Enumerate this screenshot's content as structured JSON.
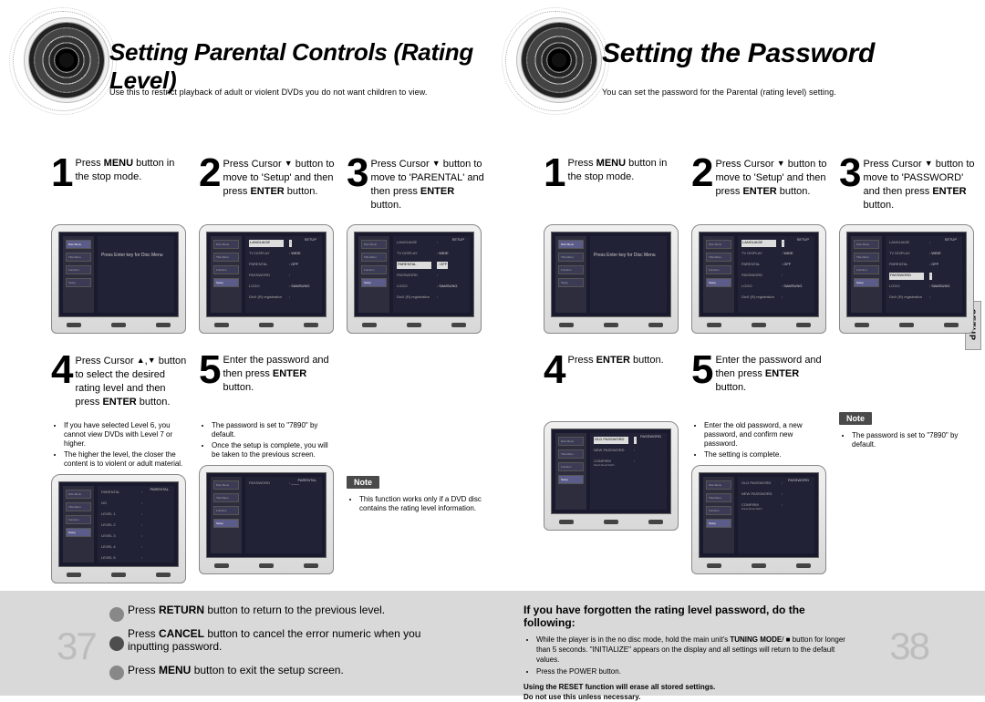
{
  "left": {
    "title": "Setting Parental Controls (Rating Level)",
    "subtitle": "Use this to restrict playback of adult or violent DVDs you do not want children to view.",
    "page_num": "37",
    "steps_row1": [
      {
        "num": "1",
        "text": "Press <b>MENU</b> button in the stop mode."
      },
      {
        "num": "2",
        "text": "Press Cursor <span class='tri'>▼</span> button to move to 'Setup' and then press <b>ENTER</b> button."
      },
      {
        "num": "3",
        "text": "Press Cursor <span class='tri'>▼</span> button to move to 'PARENTAL' and then press <b>ENTER</b> button."
      }
    ],
    "steps_row2": [
      {
        "num": "4",
        "text": "Press Cursor <span class='tri'>▲</span>,<span class='tri'>▼</span> button to select the desired rating level and then press <b>ENTER</b> button.",
        "bullets": [
          "If you have selected Level 6, you cannot view DVDs with Level 7 or higher.",
          "The higher the level, the closer the content is to violent or adult material."
        ]
      },
      {
        "num": "5",
        "text": "Enter the password and then press <b>ENTER</b> button.",
        "bullets": [
          "The password is set to \"7890\" by default.",
          "Once the setup is complete, you will be taken to the previous screen."
        ]
      }
    ],
    "note_label": "Note",
    "note_bullet": "This function works only if a DVD disc contains the rating level information.",
    "footer": [
      "Press <b>RETURN</b> button to return to the previous level.",
      "Press <b>CANCEL</b> button to cancel the error numeric when you inputting password.",
      "Press <b>MENU</b> button to exit the setup screen."
    ]
  },
  "right": {
    "title": "Setting the Password",
    "subtitle": "You can set the password for the Parental (rating level) setting.",
    "page_num": "38",
    "side_tab": "SETUP",
    "steps_row1": [
      {
        "num": "1",
        "text": "Press <b>MENU</b> button in the stop mode."
      },
      {
        "num": "2",
        "text": "Press Cursor <span class='tri'>▼</span> button to move to 'Setup' and then press <b>ENTER</b> button."
      },
      {
        "num": "3",
        "text": "Press Cursor <span class='tri'>▼</span> button to move to 'PASSWORD' and then press <b>ENTER</b> button."
      }
    ],
    "steps_row2": [
      {
        "num": "4",
        "text": "Press <b>ENTER</b> button."
      },
      {
        "num": "5",
        "text": "Enter the password and then press <b>ENTER</b> button.",
        "bullets": [
          "Enter the old password, a new password, and confirm new password.",
          "The setting is complete."
        ]
      }
    ],
    "note_label": "Note",
    "note_bullet": "The password is set to \"7890\" by default.",
    "footer_headline": "If you have forgotten the rating level password, do the following:",
    "footer_bullets": [
      "While the player is in the no disc mode, hold the main unit's <b>TUNING MODE</b>/ ■ button for longer than 5 seconds. \"INITIALIZE\" appears on the display and all settings will return to the default values.",
      "Press the POWER button."
    ],
    "footer_warn1": "Using the RESET function will erase all stored settings.",
    "footer_warn2": "Do not use this unless necessary.",
    "tv4_rows": [
      "OLD PASSWORD",
      "NEW PASSWORD",
      "CONFIRM PASSWORD"
    ]
  },
  "tv_setup_menu": [
    "Disc Menu",
    "Title Menu",
    "Function",
    "Setup"
  ],
  "tv_setup_rows": [
    {
      "lbl": "LANGUAGE",
      "val": ""
    },
    {
      "lbl": "TV DISPLAY",
      "val": "WIDE"
    },
    {
      "lbl": "PARENTAL",
      "val": "OFF"
    },
    {
      "lbl": "PASSWORD",
      "val": ""
    },
    {
      "lbl": "LOGO",
      "val": "SAMSUNG"
    },
    {
      "lbl": "DivX (R) registration",
      "val": ""
    }
  ],
  "tv_left_step1_text": "Press Enter key for Disc Menu",
  "tv_parental_levels": [
    "NO",
    "LEVEL 1",
    "LEVEL 2",
    "LEVEL 3",
    "LEVEL 4",
    "LEVEL 5",
    "LEVEL 6"
  ],
  "tv_password_label": "PASSWORD"
}
